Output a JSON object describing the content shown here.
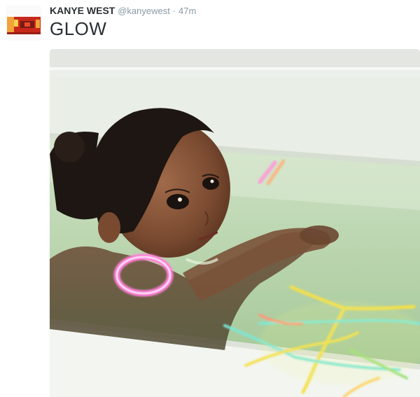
{
  "tweet": {
    "fullname": "KANYE WEST",
    "username": "@kanyewest",
    "separator": "·",
    "timestamp": "47m",
    "text": "GLOW"
  },
  "media": {
    "type": "photo",
    "glowstick_colors": [
      "#ff7fd8",
      "#f5e04a",
      "#7de8d8",
      "#ff9a7a"
    ]
  }
}
